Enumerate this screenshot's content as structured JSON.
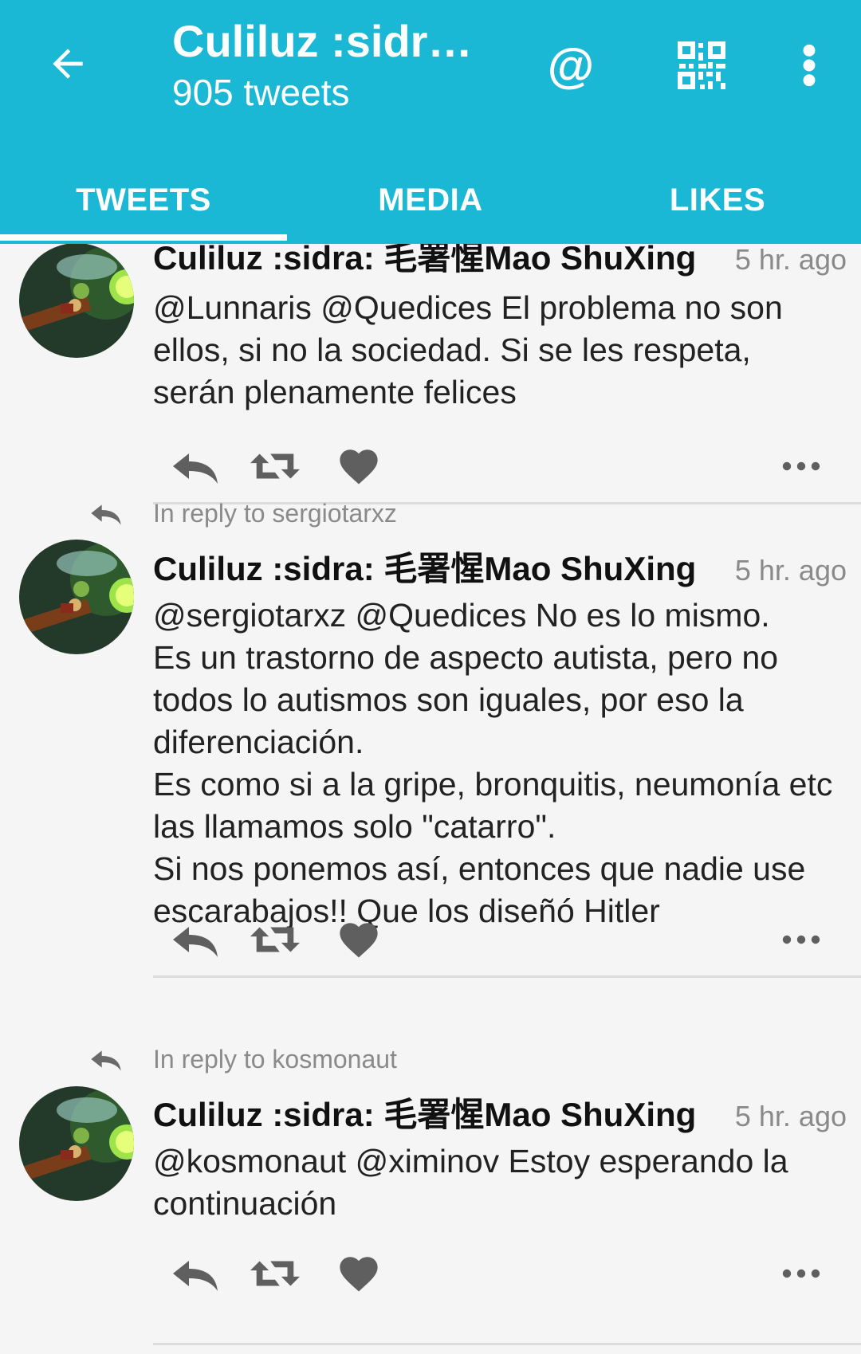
{
  "appbar": {
    "title": "Culiluz :sidr…",
    "subtitle": "905 tweets",
    "back_icon": "arrow-left-icon",
    "mention_label": "@",
    "qr_icon": "qr-code-icon",
    "more_icon": "more-vert-icon"
  },
  "tabs": [
    {
      "label": "TWEETS",
      "selected": true
    },
    {
      "label": "MEDIA",
      "selected": false
    },
    {
      "label": "LIKES",
      "selected": false
    }
  ],
  "colors": {
    "accent": "#1ab8d4",
    "tab_indicator": "#ffffff",
    "muted": "#8a8a8a"
  },
  "tweets": [
    {
      "reply_to": "",
      "author": "Culiluz :sidra: 毛署惺Mao ShuXing",
      "time": "5 hr. ago",
      "text": "@Lunnaris @Quedices El problema no son ellos, si no la sociedad. Si se les respeta, serán plenamente felices"
    },
    {
      "reply_to": "In reply to sergiotarxz",
      "author": "Culiluz :sidra: 毛署惺Mao ShuXing",
      "time": "5 hr. ago",
      "text": "@sergiotarxz @Quedices No es lo mismo.\nEs un trastorno de aspecto autista, pero no todos lo autismos son iguales, por eso la diferenciación.\nEs como si a la gripe, bronquitis, neumonía etc las llamamos solo \"catarro\".\nSi nos ponemos así, entonces que nadie use escarabajos!! Que los diseñó Hitler"
    },
    {
      "reply_to": "In reply to kosmonaut",
      "author": "Culiluz :sidra: 毛署惺Mao ShuXing",
      "time": "5 hr. ago",
      "text": "@kosmonaut @ximinov Estoy esperando la continuación"
    }
  ],
  "action_icons": [
    "reply-icon",
    "retweet-icon",
    "heart-icon",
    "more-horiz-icon"
  ]
}
